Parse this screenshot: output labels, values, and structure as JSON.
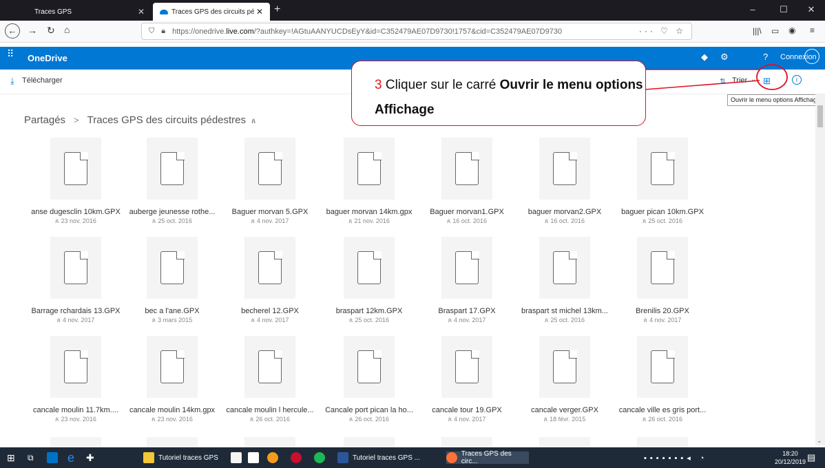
{
  "browser": {
    "tabs": [
      {
        "label": "Traces GPS"
      },
      {
        "label": "Traces GPS des circuits pédestr"
      }
    ],
    "url_prefix": "https://onedrive.",
    "url_domain": "live.com",
    "url_suffix": "/?authkey=!AGtuAANYUCDsEyY&id=C352479AE07D9730!1757&cid=C352479AE07D9730"
  },
  "header": {
    "app_name": "OneDrive",
    "connexion": "Connexion"
  },
  "commandbar": {
    "download": "Télécharger",
    "sort": "Trier"
  },
  "tooltip": "Ouvrir le menu options Affichage",
  "callout": {
    "number": "3",
    "text_plain": " Cliquer sur le carré ",
    "text_bold": "Ouvrir le menu options Affichage"
  },
  "breadcrumb": {
    "root": "Partagés",
    "separator": ">",
    "current": "Traces GPS des circuits pédestres"
  },
  "files": [
    {
      "name": "anse dugesclin 10km.GPX",
      "date": "23 nov. 2016"
    },
    {
      "name": "auberge jeunesse rothe...",
      "date": "25 oct. 2016"
    },
    {
      "name": "Baguer morvan 5.GPX",
      "date": "4 nov. 2017"
    },
    {
      "name": "baguer morvan 14km.gpx",
      "date": "21 nov. 2016"
    },
    {
      "name": "Baguer morvan1.GPX",
      "date": "16 oct. 2016"
    },
    {
      "name": "baguer morvan2.GPX",
      "date": "16 oct. 2016"
    },
    {
      "name": "baguer pican 10km.GPX",
      "date": "25 oct. 2016"
    },
    {
      "name": "Barrage rchardais 13.GPX",
      "date": "4 nov. 2017"
    },
    {
      "name": "bec a l'ane.GPX",
      "date": "3 mars 2015"
    },
    {
      "name": "becherel 12.GPX",
      "date": "4 nov. 2017"
    },
    {
      "name": "braspart 12km.GPX",
      "date": "25 oct. 2016"
    },
    {
      "name": "Braspart 17.GPX",
      "date": "4 nov. 2017"
    },
    {
      "name": "braspart st michel 13km...",
      "date": "25 oct. 2016"
    },
    {
      "name": "Brenilis 20.GPX",
      "date": "4 nov. 2017"
    },
    {
      "name": "cancale moulin 11.7km....",
      "date": "23 nov. 2016"
    },
    {
      "name": "cancale moulin 14km.gpx",
      "date": "23 nov. 2016"
    },
    {
      "name": "cancale moulin l hercule...",
      "date": "26 oct. 2016"
    },
    {
      "name": "Cancale port pican la ho...",
      "date": "26 oct. 2016"
    },
    {
      "name": "cancale tour 19.GPX",
      "date": "4 nov. 2017"
    },
    {
      "name": "cancale verger.GPX",
      "date": "18 févr. 2015"
    },
    {
      "name": "cancale ville es gris port...",
      "date": "26 oct. 2016"
    }
  ],
  "taskbar": {
    "items": [
      {
        "label": "Tutoriel traces GPS"
      },
      {
        "label": "Tutoriel traces GPS ..."
      },
      {
        "label": "Traces GPS des circ..."
      }
    ],
    "time": "18:20",
    "date": "20/12/2019"
  },
  "colors": {
    "brand": "#0078d4",
    "callout_border": "#dd1122",
    "callout_number": "#e0161c"
  }
}
